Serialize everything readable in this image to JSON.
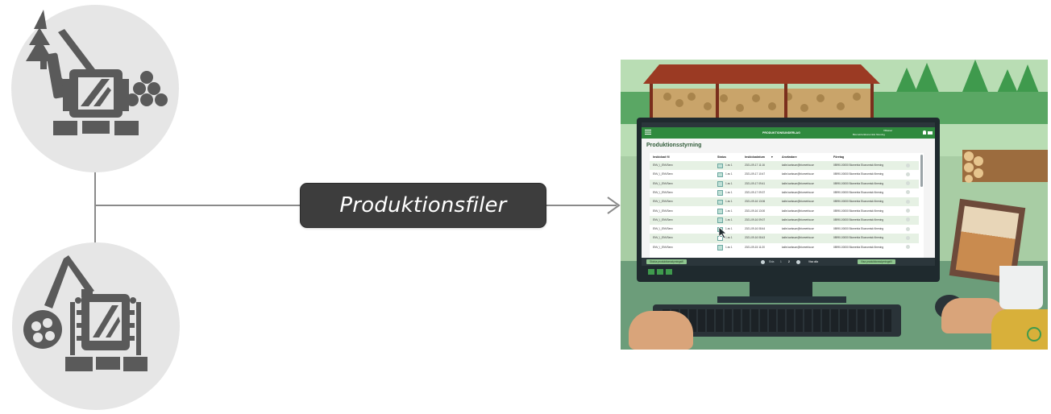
{
  "arrow_label": "Produktionsfiler",
  "icons": {
    "top": "harvester-icon",
    "bottom": "forwarder-icon"
  },
  "app": {
    "header_title": "PRODUKTIONSUNDERLAG",
    "user_name": "Villasser",
    "company": "Biometria Ekonomisk förening",
    "page_title": "Produktionsstyrning",
    "columns": [
      "Inskickad fil",
      "Status",
      "Inskickadatum",
      "Användare",
      "Företag"
    ],
    "rows": [
      {
        "file": "ENV_I_ENVSenv",
        "status": "1 av 1",
        "date": "2021-09-17 11:16",
        "user": "kalle.karlsson@biometria.se",
        "company": "08990-00000 Biometria Ekonomisk förening",
        "checked": true
      },
      {
        "file": "ENV_I_ENVSenv",
        "status": "1 av 1",
        "date": "2021-09-17 10:47",
        "user": "kalle.karlsson@biometria.se",
        "company": "08990-00000 Biometria Ekonomisk förening",
        "checked": true
      },
      {
        "file": "ENV_I_ENVSenv",
        "status": "1 av 1",
        "date": "2021-09-17 09:41",
        "user": "kalle.karlsson@biometria.se",
        "company": "08990-00000 Biometria Ekonomisk förening",
        "checked": true
      },
      {
        "file": "ENV_I_ENVSenv",
        "status": "1 av 1",
        "date": "2021-09-17 09:37",
        "user": "kalle.karlsson@biometria.se",
        "company": "08990-00000 Biometria Ekonomisk förening",
        "checked": true
      },
      {
        "file": "ENV_I_ENVSenv",
        "status": "1 av 1",
        "date": "2021-09-16 13:06",
        "user": "kalle.karlsson@biometria.se",
        "company": "08990-00000 Biometria Ekonomisk förening",
        "checked": true
      },
      {
        "file": "ENV_I_ENVSenv",
        "status": "1 av 1",
        "date": "2021-09-16 13:00",
        "user": "kalle.karlsson@biometria.se",
        "company": "08990-00000 Biometria Ekonomisk förening",
        "checked": true
      },
      {
        "file": "ENV_I_ENVSenv",
        "status": "1 av 1",
        "date": "2021-09-16 09:07",
        "user": "kalle.karlsson@biometria.se",
        "company": "08990-00000 Biometria Ekonomisk förening",
        "checked": true
      },
      {
        "file": "ENV_I_ENVSenv",
        "status": "1 av 1",
        "date": "2021-09-16 08:44",
        "user": "kalle.karlsson@biometria.se",
        "company": "08990-00000 Biometria Ekonomisk förening",
        "checked": true
      },
      {
        "file": "ENV_I_ENVSenv",
        "status": "1 av 1",
        "date": "2021-09-16 08:43",
        "user": "kalle.karlsson@biometria.se",
        "company": "08990-00000 Biometria Ekonomisk förening",
        "checked": false
      },
      {
        "file": "ENV_I_ENVSenv",
        "status": "1 av 1",
        "date": "2021-09-15 11:20",
        "user": "kalle.karlsson@biometria.se",
        "company": "08990-00000 Biometria Ekonomisk förening",
        "checked": true
      }
    ],
    "footer_left": "Skicka produktionsstyrningsfil",
    "page_label": "Sida",
    "page_current": "1",
    "page_total": "2",
    "show_all": "Visa alla",
    "footer_right": "Visa produktionsstyrningsfil"
  },
  "colors": {
    "icon_gray": "#5a5a5a",
    "circle_bg": "#e6e6e6",
    "label_bg": "#3d3d3d",
    "app_green": "#2f8a3e"
  }
}
